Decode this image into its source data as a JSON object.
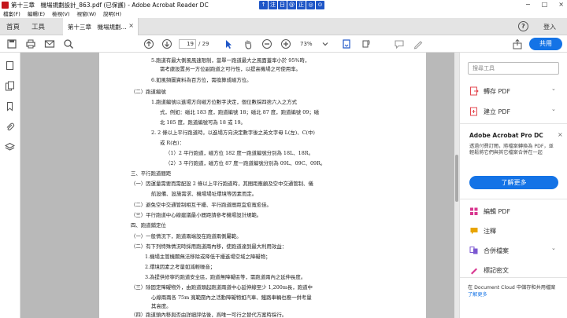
{
  "window": {
    "title": "第十三章　機場規劃設計_863.pdf (已保護) - Adobe Acrobat Reader DC",
    "center_tools": [
      "↑",
      "注",
      "日",
      "@",
      "正",
      "◎",
      "⊙"
    ],
    "controls": [
      "−",
      "□",
      "×"
    ]
  },
  "menu": [
    "檔案(F)",
    "編輯(E)",
    "檢視(V)",
    "視窗(W)",
    "說明(H)"
  ],
  "tabs": {
    "home": "首頁",
    "tools": "工具",
    "document": "第十三章　機場規劃...",
    "close": "×",
    "signin": "登入",
    "help": "?"
  },
  "toolbar": {
    "current_page": "19",
    "total_pages": "/ 29",
    "zoom": "73%",
    "share": "共用"
  },
  "document_lines": [
    "5.跑道有最大側風風速限制，當單一跑道最大之風面蓋率小於 95%時，",
    "需考慮設置另一方位副跑道之可行性，以提高機場之可使用率。",
    "6.如風頻圖資料為百方位，需換算成磁方位。",
    "（二）跑道編號",
    "1.跑道編號以進場方向磁方位數字決定，個位數採四捨六入之方式",
    "式，例如：磁北 183 度，跑道編號 18；磁北 87 度，跑道編號 09；磁",
    "北 185 度，跑道編號可為 18 或 19。",
    "2. 2 條以上平行跑道時，以進場方向決定數字後之英文字母 L(左)、C(中)",
    "或 R(右)：",
    "（1）2 平行跑道，磁方位 182 度一跑道編號分別為 18L、18R。",
    "（2）3 平行跑道，磁方位 87 度一跑道編號分別為 09L、09C、09R。",
    "三、平行跑道間距",
    "（一）因運量需要而需配設 2 條以上平行跑道時，其間距應顧及空中交通管制、儀",
    "航設備、設施需求、機場場址環境等因素而定。",
    "（二）避免空中交通管制相互干擾、平行跑道間距宜愈寬愈佳。",
    "（三）平行跑道中心線建議最小間距請參考機場設計規範。",
    "四、跑道鋪定位",
    "（一）一般情況下，跑道兩端設在跑道兩側屬範。",
    "（二）有下列特殊情況時採用跑道兩內移，使跑道達到最大利用效益：",
    "1.機場主管機關無法移除或降低干擾進場空域之障礙物；",
    "2.環境因素之考量如減輕噪音；",
    "3.為提供修寧的跑道安全區，跑道無障礙區等，需跑道兩內之延伸長度。",
    "（三）除固定障礙物外，由跑道頭起跑道兩道中心延伸線至少 1,200m長，跑道中",
    "心線兩兩各 75m 寬範圍內之活動障礙物如汽車、鐵路車輛也應一併考量",
    "其高度。",
    "（四）跑道頭內移與否由詳細評估後，爲唯一可行之替代方案時採行。"
  ],
  "right_panel": {
    "search_placeholder": "搜尋工具",
    "export_pdf": "轉存 PDF",
    "create_pdf": "建立 PDF",
    "promo_title": "Adobe Acrobat Pro DC",
    "promo_close": "×",
    "promo_text": "透過付費訂閱，將檔案轉換為 PDF，並輕鬆將它們與其它檔案合併在一起",
    "learn_more": "了解更多",
    "edit_pdf": "編輯 PDF",
    "comment": "注釋",
    "combine_files": "合併檔案",
    "organize": "標記密文",
    "footer_text": "在 Document Cloud 中儲存和共用檔案",
    "footer_link": "了解更多"
  },
  "colors": {
    "accent_blue": "#1473e6",
    "acrobat_red": "#c4161c",
    "doc_bg": "#b9b9b9"
  }
}
